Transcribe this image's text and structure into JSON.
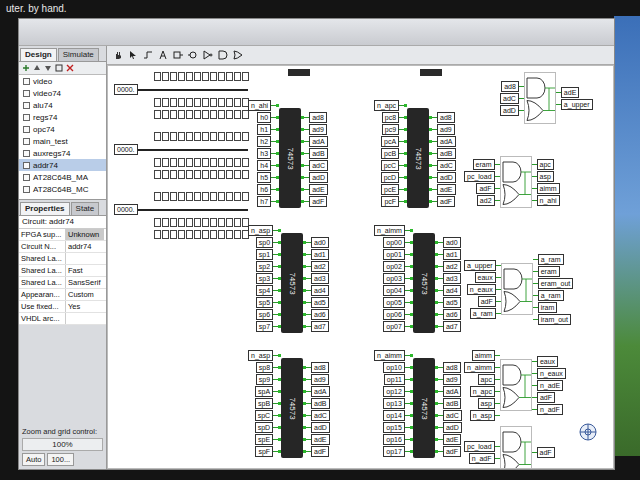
{
  "bezel_text": "uter. by hand.",
  "tabs": [
    {
      "label": "Design",
      "selected": true
    },
    {
      "label": "Simulate",
      "selected": false
    }
  ],
  "tree": [
    {
      "label": "video",
      "selected": false
    },
    {
      "label": "video74",
      "selected": false
    },
    {
      "label": "alu74",
      "selected": false
    },
    {
      "label": "regs74",
      "selected": false
    },
    {
      "label": "opc74",
      "selected": false
    },
    {
      "label": "main_test",
      "selected": false
    },
    {
      "label": "auxregs74",
      "selected": false
    },
    {
      "label": "addr74",
      "selected": true
    },
    {
      "label": "AT28C64B_MA",
      "selected": false
    },
    {
      "label": "AT28C64B_MC",
      "selected": false
    }
  ],
  "property_tabs": [
    {
      "label": "Properties",
      "selected": true
    },
    {
      "label": "State",
      "selected": false
    }
  ],
  "properties_header": "Circuit: addr74",
  "properties": [
    {
      "name": "FPGA sup...",
      "value": "Unknown",
      "selected": true
    },
    {
      "name": "Circuit N...",
      "value": "addr74",
      "selected": false
    },
    {
      "name": "Shared La...",
      "selected": false
    },
    {
      "name": "Shared La...",
      "value": "Fast",
      "selected": false
    },
    {
      "name": "Shared La...",
      "value": "SansSerif",
      "selected": false
    },
    {
      "name": "Appearan...",
      "value": "Custom",
      "selected": false
    },
    {
      "name": "Use fixed...",
      "value": "Yes",
      "selected": false
    },
    {
      "name": "VHDL arc...",
      "selected": false
    }
  ],
  "zoom": {
    "label": "Zoom and grid control:",
    "value": "100%",
    "auto": "Auto",
    "field": "100..."
  },
  "canvas": {
    "splitters": [
      {
        "label": "0000."
      },
      {
        "label": "0000."
      },
      {
        "label": "0000."
      }
    ],
    "chips": [
      {
        "part": "74573",
        "enable": "n_ahi",
        "inputs": [
          "h0",
          "h1",
          "h2",
          "h3",
          "h4",
          "h5",
          "h6",
          "h7"
        ],
        "outputs": [
          "ad8",
          "ad9",
          "adA",
          "adB",
          "adC",
          "adD",
          "adE",
          "adF"
        ]
      },
      {
        "part": "74573",
        "enable": "n_apc",
        "inputs": [
          "pc8",
          "pc9",
          "pcA",
          "pcB",
          "pcC",
          "pcD",
          "pcE",
          "pcF"
        ],
        "outputs": [
          "ad8",
          "ad9",
          "adA",
          "adB",
          "adC",
          "adD",
          "adE",
          "adF"
        ]
      },
      {
        "part": "74573",
        "enable": "n_asp",
        "inputs": [
          "sp0",
          "sp1",
          "sp2",
          "sp3",
          "sp4",
          "sp5",
          "sp6",
          "sp7"
        ],
        "outputs": [
          "ad0",
          "ad1",
          "ad2",
          "ad3",
          "ad4",
          "ad5",
          "ad6",
          "ad7"
        ]
      },
      {
        "part": "74573",
        "enable": "n_aimm",
        "inputs": [
          "op00",
          "op01",
          "op02",
          "op03",
          "op04",
          "op05",
          "op06",
          "op07"
        ],
        "outputs": [
          "ad0",
          "ad1",
          "ad2",
          "ad3",
          "ad4",
          "ad5",
          "ad6",
          "ad7"
        ]
      },
      {
        "part": "74573",
        "enable": "n_asp",
        "inputs": [
          "sp8",
          "sp9",
          "spA",
          "spB",
          "spC",
          "spD",
          "spE",
          "spF"
        ],
        "outputs": [
          "ad8",
          "ad9",
          "adA",
          "adB",
          "adC",
          "adD",
          "adE",
          "adF"
        ]
      },
      {
        "part": "74573",
        "enable": "n_aimm",
        "inputs": [
          "op10",
          "op11",
          "op12",
          "op13",
          "op14",
          "op15",
          "op16",
          "op17"
        ],
        "outputs": [
          "ad8",
          "ad9",
          "adA",
          "adB",
          "adC",
          "adD",
          "adE",
          "adF"
        ]
      }
    ],
    "logic_blocks": [
      {
        "inputs": [
          "ad8",
          "adC",
          "adD"
        ],
        "outputs": [
          "adE",
          "a_upper"
        ]
      },
      {
        "inputs": [
          "eram",
          "pc_load",
          "adF",
          "ad2"
        ],
        "outputs": [
          "apc",
          "asp",
          "aimm",
          "n_ahi"
        ]
      },
      {
        "inputs": [
          "a_upper",
          "eaux",
          "n_eaux",
          "adF",
          "a_ram"
        ],
        "outputs": [
          "a_ram",
          "eram",
          "eram_out",
          "a_ram",
          "iram",
          "iram_out"
        ]
      },
      {
        "inputs": [
          "aimm",
          "n_aimm",
          "apc",
          "n_apc",
          "asp",
          "n_asp"
        ],
        "outputs": [
          "eaux",
          "n_eaux",
          "n_adE",
          "adF",
          "n_adF"
        ]
      },
      {
        "inputs": [
          "pc_load",
          "n_adF"
        ],
        "outputs": [
          "adF"
        ]
      }
    ]
  }
}
